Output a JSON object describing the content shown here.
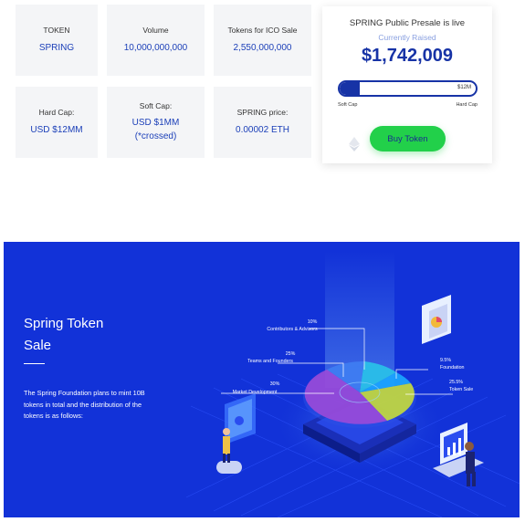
{
  "stats": [
    {
      "label": "TOKEN",
      "value": "SPRING"
    },
    {
      "label": "Volume",
      "value": "10,000,000,000"
    },
    {
      "label": "Tokens for ICO Sale",
      "value": "2,550,000,000"
    },
    {
      "label": "Hard Cap:",
      "value": "USD $12MM"
    },
    {
      "label": "Soft Cap:",
      "value_line1": "USD $1MM",
      "value_line2": "(*crossed)"
    },
    {
      "label": "SPRING price:",
      "value": "0.00002 ETH"
    }
  ],
  "presale": {
    "title": "SPRING Public Presale is live",
    "subtitle": "Currently Raised",
    "amount": "$1,742,009",
    "progress_fraction": 0.145,
    "cap_marker": "$12M",
    "soft_cap_label": "Soft Cap",
    "hard_cap_label": "Hard Cap",
    "buy_label": "Buy Token"
  },
  "hero": {
    "title_line1": "Spring Token",
    "title_line2": "Sale",
    "description": "The Spring Foundation plans to mint 10B tokens in total and the distribution of the tokens is as follows:"
  },
  "distribution": [
    {
      "percent": "10%",
      "name": "Contributors & Advisors",
      "color": "#29c4e8"
    },
    {
      "percent": "25%",
      "name": "Teams and Founders",
      "color": "#3f7ef2"
    },
    {
      "percent": "9.5%",
      "name": "Foundation",
      "color": "#1aa6ff"
    },
    {
      "percent": "25.5%",
      "name": "Token Sale",
      "color": "#c8dd3a"
    },
    {
      "percent": "30%",
      "name": "Market Development",
      "color": "#9b4ad8"
    }
  ],
  "colors": {
    "primary": "#1733a6",
    "hero_bg": "#1232d8",
    "buy_button": "#22d04a",
    "card_bg": "#f4f5f7"
  }
}
